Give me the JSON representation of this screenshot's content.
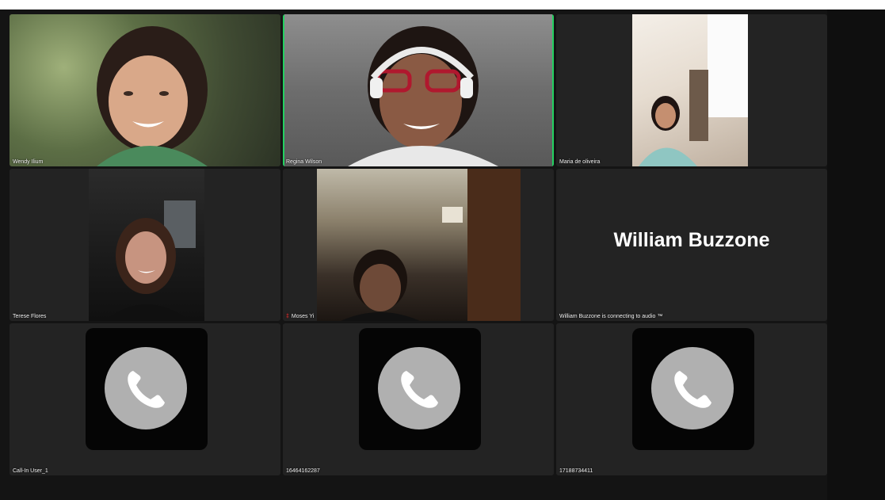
{
  "participants": [
    {
      "name": "Wendy Ilium",
      "type": "video",
      "active": false
    },
    {
      "name": "Regina Wilson",
      "type": "video",
      "active": true
    },
    {
      "name": "Maria de oliveira",
      "type": "video",
      "active": false
    },
    {
      "name": "Terese Flores",
      "type": "video",
      "active": false
    },
    {
      "name": "Moses Yi",
      "type": "video",
      "active": false,
      "muted": true
    },
    {
      "name": "William Buzzone",
      "type": "name-only",
      "status": "William Buzzone is connecting to audio ™"
    },
    {
      "name": "Call-In User_1",
      "type": "phone"
    },
    {
      "name": "16464162287",
      "type": "phone"
    },
    {
      "name": "17188734411",
      "type": "phone"
    }
  ],
  "muted_glyph": "‡",
  "colors": {
    "active_border": "#23d160",
    "tile_bg": "#232323",
    "phone_icon_bg": "#b0b0b0"
  },
  "icons": {
    "phone": "phone-icon",
    "mute": "mic-muted-icon"
  }
}
